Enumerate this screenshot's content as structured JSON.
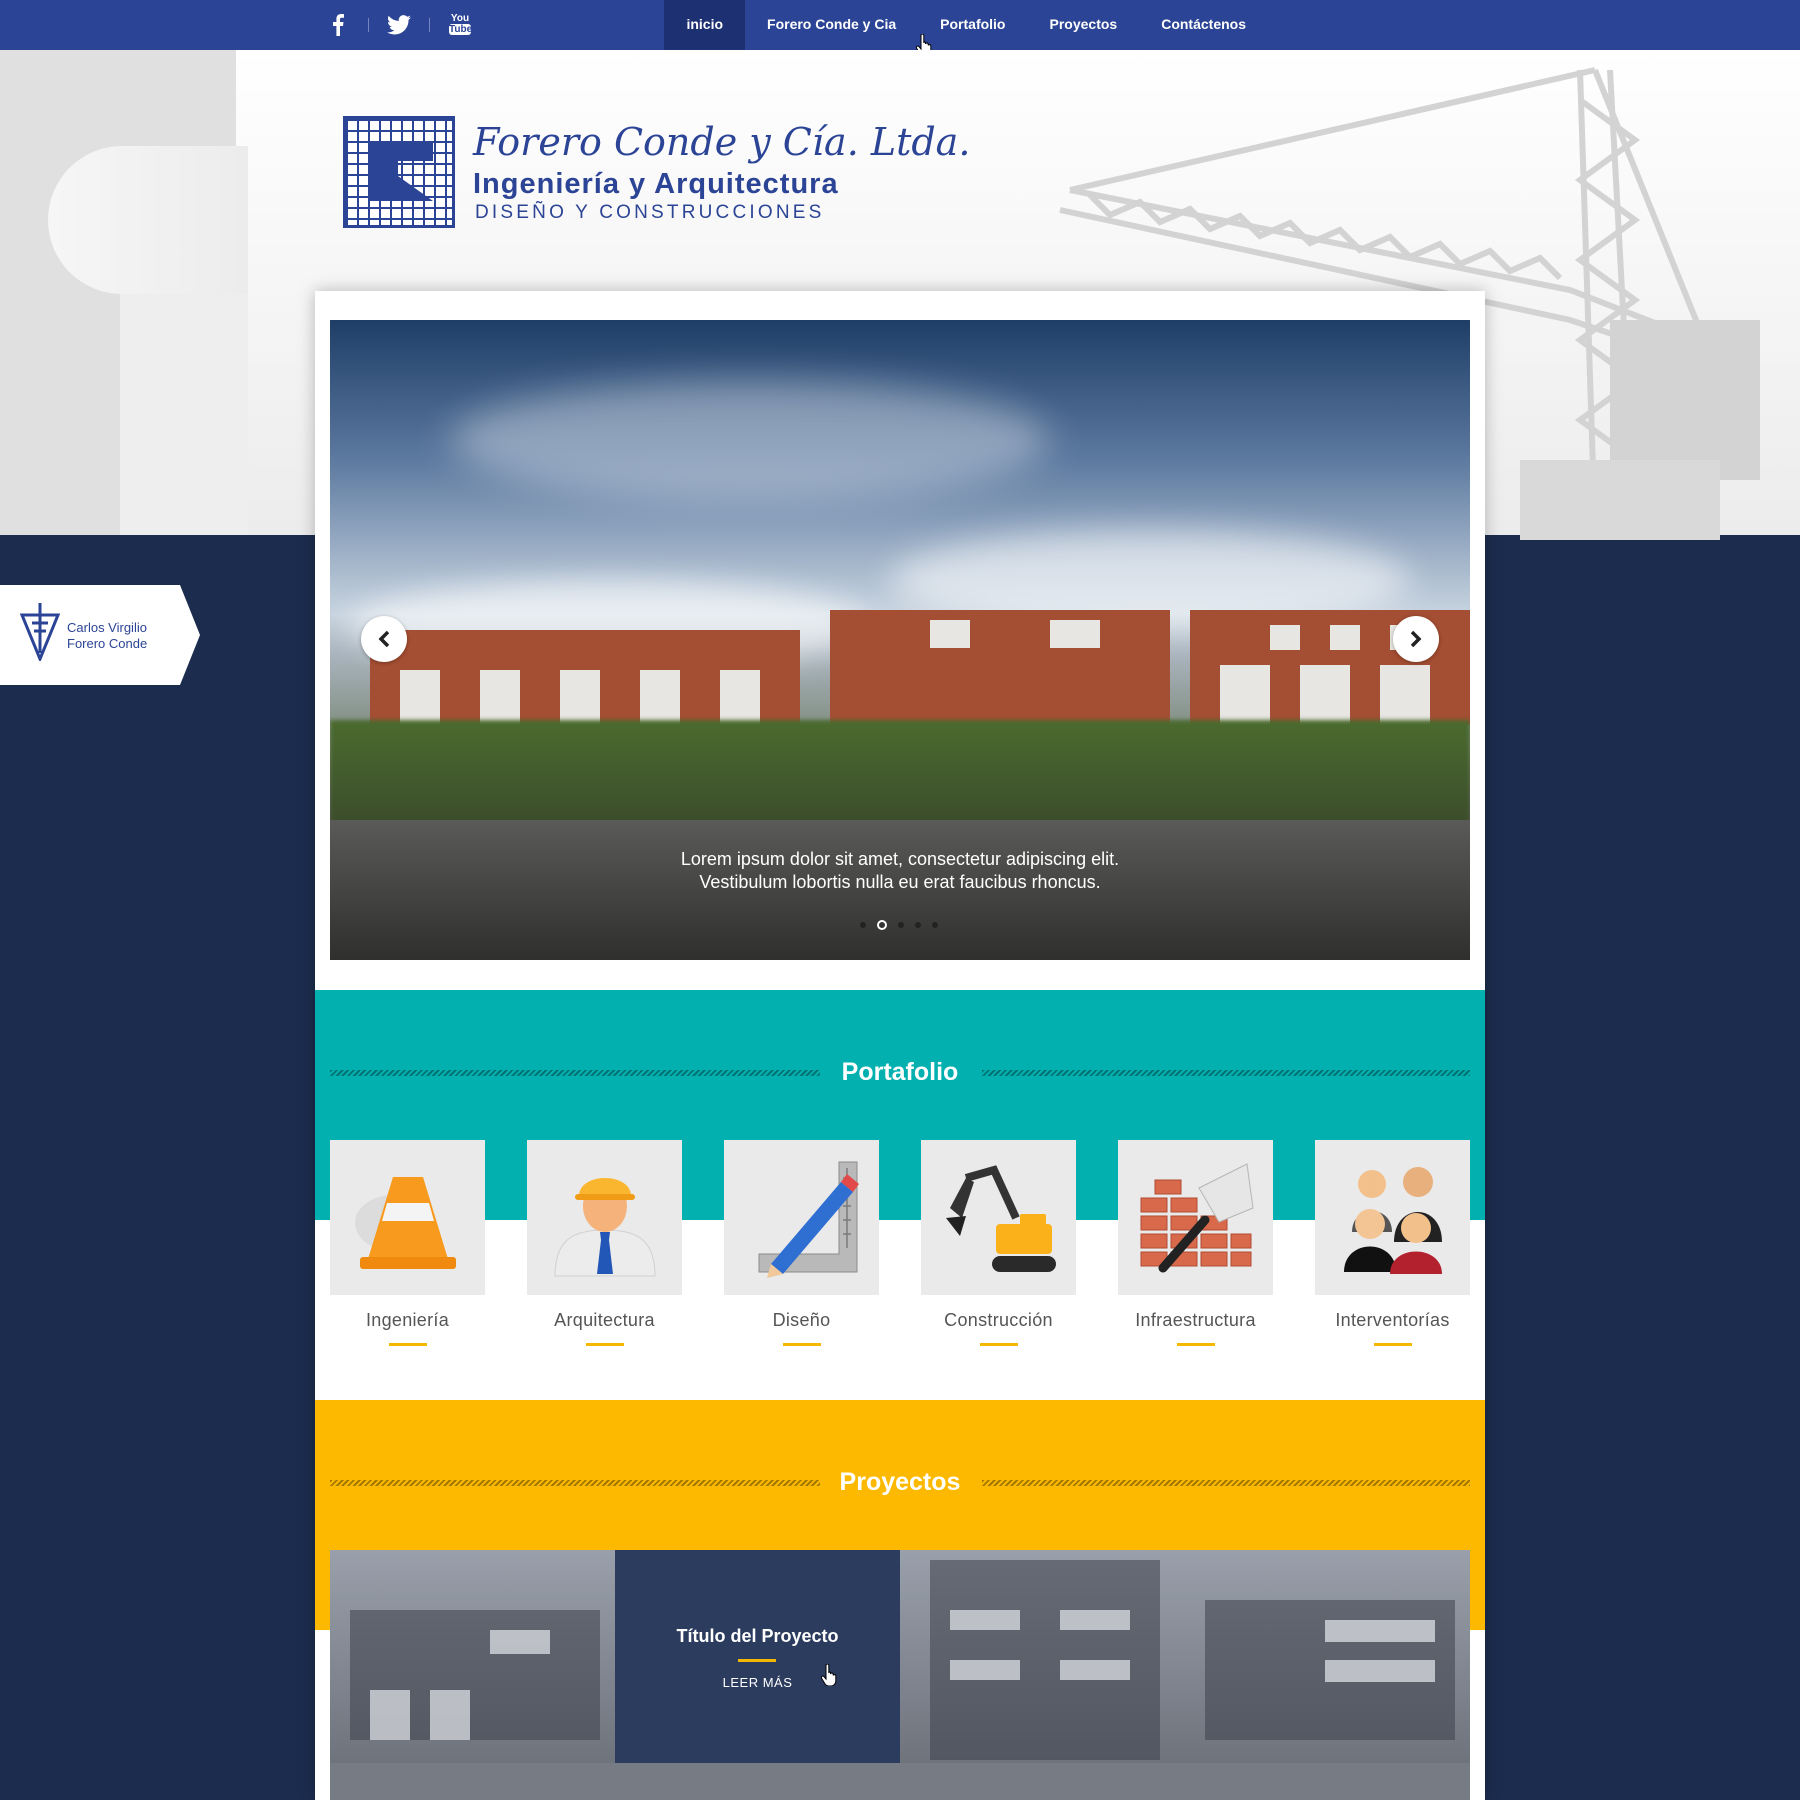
{
  "nav": {
    "items": [
      "inicio",
      "Forero Conde y Cia",
      "Portafolio",
      "Proyectos",
      "Contáctenos"
    ],
    "active": "inicio"
  },
  "social": {
    "facebook_icon": "facebook-icon",
    "twitter_icon": "twitter-icon",
    "youtube_icon": "youtube-icon",
    "youtube_you": "You",
    "youtube_tube": "Tube"
  },
  "logo": {
    "script": "Forero Conde y Cía. Ltda.",
    "line2": "Ingeniería y Arquitectura",
    "line3": "DISEÑO Y CONSTRUCCIONES"
  },
  "badge": {
    "line1": "Carlos Virgilio",
    "line2": "Forero Conde"
  },
  "slider": {
    "caption_line1": "Lorem ipsum dolor sit amet, consectetur adipiscing elit.",
    "caption_line2": "Vestibulum lobortis nulla eu erat faucibus rhoncus.",
    "slide_count": 5,
    "active_slide": 2
  },
  "portafolio": {
    "title": "Portafolio",
    "items": [
      {
        "label": "Ingeniería",
        "icon": "traffic-cone-icon"
      },
      {
        "label": "Arquitectura",
        "icon": "engineer-icon"
      },
      {
        "label": "Diseño",
        "icon": "pencil-ruler-icon"
      },
      {
        "label": "Construcción",
        "icon": "excavator-icon"
      },
      {
        "label": "Infraestructura",
        "icon": "bricks-trowel-icon"
      },
      {
        "label": "Interventorías",
        "icon": "people-group-icon"
      }
    ]
  },
  "proyectos": {
    "title": "Proyectos",
    "featured_title": "Título del Proyecto",
    "read_more": "LEER MÁS"
  },
  "colors": {
    "nav_bg": "#2b4496",
    "nav_active": "#1d3072",
    "page_bg": "#1c2c4e",
    "teal": "#02b0b0",
    "yellow": "#fcb900",
    "accent_underline": "#f5b800"
  }
}
